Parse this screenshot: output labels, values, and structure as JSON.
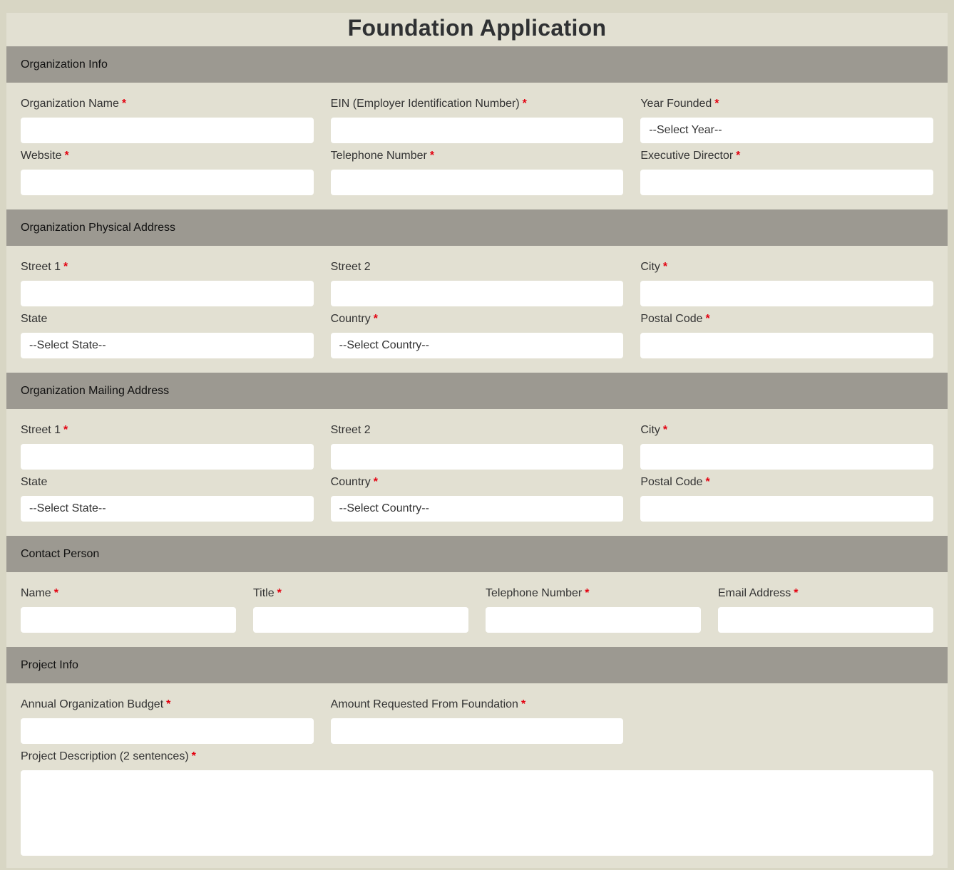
{
  "form": {
    "title": "Foundation Application",
    "required_mark": "*"
  },
  "sections": {
    "org_info": {
      "header": "Organization Info",
      "org_name_label": "Organization Name",
      "ein_label": "EIN (Employer Identification Number)",
      "year_founded_label": "Year Founded",
      "year_founded_value": "--Select Year--",
      "website_label": "Website",
      "telephone_label": "Telephone Number",
      "exec_director_label": "Executive Director"
    },
    "physical_address": {
      "header": "Organization Physical Address",
      "street1_label": "Street 1",
      "street2_label": "Street 2",
      "city_label": "City",
      "state_label": "State",
      "state_value": "--Select State--",
      "country_label": "Country",
      "country_value": "--Select Country--",
      "postal_label": "Postal Code"
    },
    "mailing_address": {
      "header": "Organization Mailing Address",
      "street1_label": "Street 1",
      "street2_label": "Street 2",
      "city_label": "City",
      "state_label": "State",
      "state_value": "--Select State--",
      "country_label": "Country",
      "country_value": "--Select Country--",
      "postal_label": "Postal Code"
    },
    "contact_person": {
      "header": "Contact Person",
      "name_label": "Name",
      "title_label": "Title",
      "telephone_label": "Telephone Number",
      "email_label": "Email Address"
    },
    "project_info": {
      "header": "Project Info",
      "budget_label": "Annual Organization Budget",
      "amount_label": "Amount Requested From Foundation",
      "description_label": "Project Description (2 sentences)"
    }
  },
  "colors": {
    "page_background": "#d8d6c4",
    "card_background": "#e2e0d2",
    "section_header": "#9c9991",
    "required": "#e3000f"
  }
}
